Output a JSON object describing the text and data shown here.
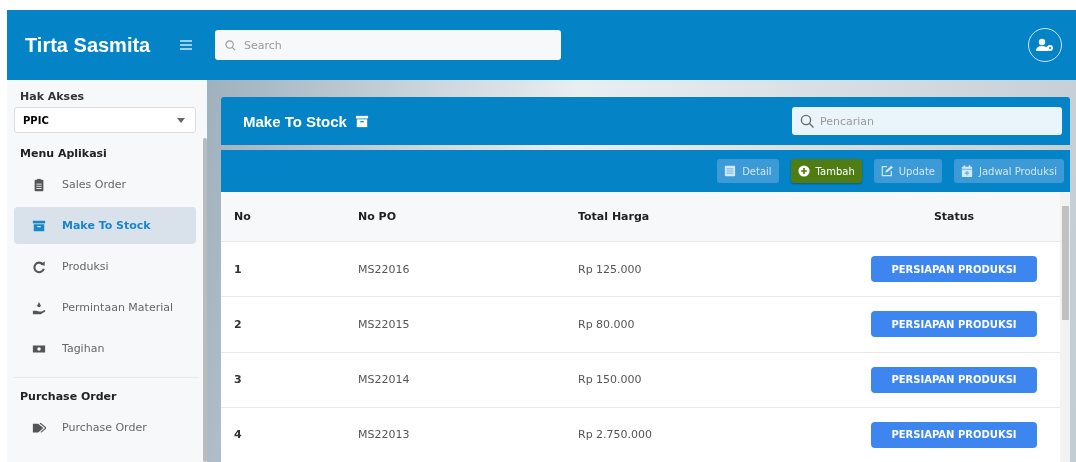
{
  "header": {
    "brand": "Tirta Sasmita",
    "search": {
      "placeholder": "Search"
    }
  },
  "sidebar": {
    "access_label": "Hak Akses",
    "access_value": "PPIC",
    "sections": [
      {
        "title": "Menu Aplikasi",
        "items": [
          {
            "label": "Sales Order",
            "kind": "clipboard",
            "selected": false
          },
          {
            "label": "Make To Stock",
            "kind": "archive",
            "selected": true
          },
          {
            "label": "Produksi",
            "kind": "redo",
            "selected": false
          },
          {
            "label": "Permintaan Material",
            "kind": "hand",
            "selected": false
          },
          {
            "label": "Tagihan",
            "kind": "money",
            "selected": false
          }
        ]
      },
      {
        "title": "Purchase Order",
        "items": [
          {
            "label": "Purchase Order",
            "kind": "tags",
            "selected": false
          }
        ]
      }
    ]
  },
  "page": {
    "title": "Make To Stock",
    "search": {
      "placeholder": "Pencarian"
    },
    "toolbar": [
      {
        "label": "Detail",
        "kind": "list",
        "disabled": true
      },
      {
        "label": "Tambah",
        "kind": "plus",
        "disabled": false
      },
      {
        "label": "Update",
        "kind": "edit",
        "disabled": true
      },
      {
        "label": "Jadwal Produksi",
        "kind": "calendar",
        "disabled": true
      }
    ],
    "table": {
      "columns": [
        "No",
        "No PO",
        "Total Harga",
        "Status"
      ],
      "rows": [
        {
          "no": "1",
          "po": "MS22016",
          "total": "Rp 125.000",
          "status": "PERSIAPAN PRODUKSI"
        },
        {
          "no": "2",
          "po": "MS22015",
          "total": "Rp 80.000",
          "status": "PERSIAPAN PRODUKSI"
        },
        {
          "no": "3",
          "po": "MS22014",
          "total": "Rp 150.000",
          "status": "PERSIAPAN PRODUKSI"
        },
        {
          "no": "4",
          "po": "MS22013",
          "total": "Rp 2.750.000",
          "status": "PERSIAPAN PRODUKSI"
        }
      ]
    }
  }
}
